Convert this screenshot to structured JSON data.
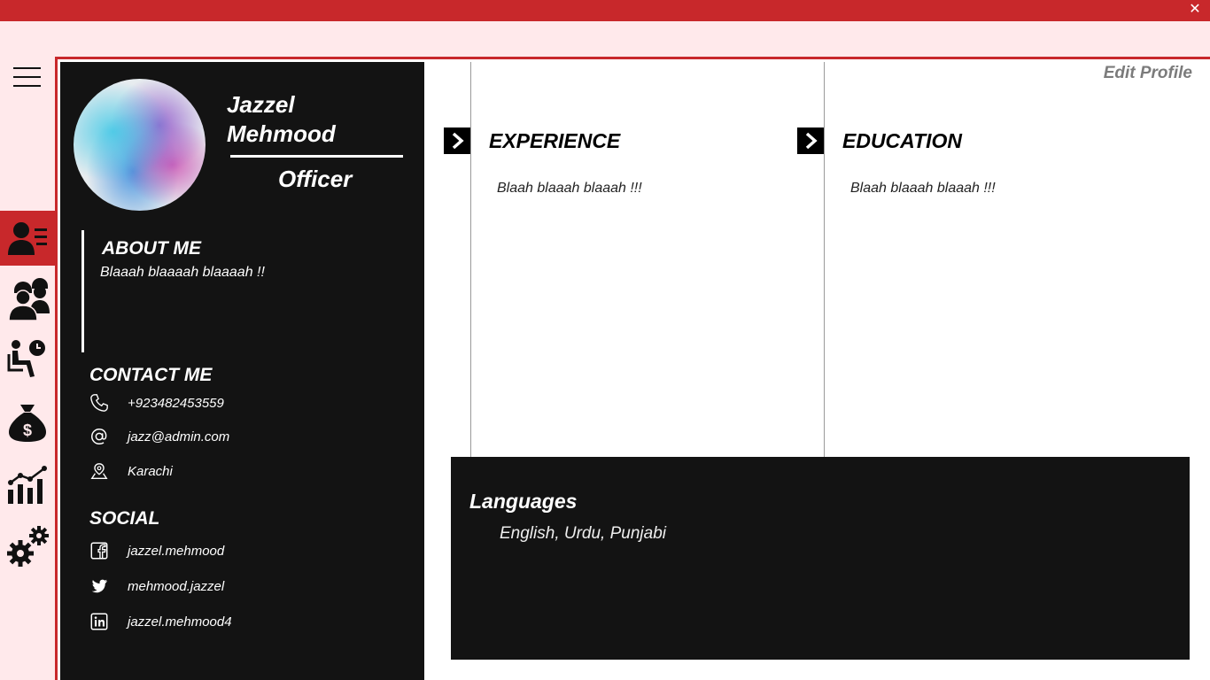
{
  "window": {
    "close_glyph": "✕"
  },
  "nav": {
    "items": [
      {
        "icon": "profile-list-icon",
        "active": true
      },
      {
        "icon": "workers-icon",
        "active": false
      },
      {
        "icon": "waiting-time-icon",
        "active": false
      },
      {
        "icon": "money-bag-icon",
        "active": false
      },
      {
        "icon": "growth-chart-icon",
        "active": false
      },
      {
        "icon": "settings-gears-icon",
        "active": false
      }
    ]
  },
  "profile": {
    "name_first": "Jazzel",
    "name_last": "Mehmood",
    "role": "Officer",
    "about_title": "ABOUT ME",
    "about_text": "Blaaah blaaaah blaaaah !!",
    "contact_title": "CONTACT ME",
    "phone": "+923482453559",
    "email": "jazz@admin.com",
    "location": "Karachi",
    "social_title": "SOCIAL",
    "facebook": "jazzel.mehmood",
    "twitter": "mehmood.jazzel",
    "linkedin": "jazzel.mehmood4"
  },
  "main": {
    "edit_profile": "Edit Profile",
    "experience_title": "EXPERIENCE",
    "experience_text": "Blaah blaaah blaaah !!!",
    "education_title": "EDUCATION",
    "education_text": "Blaah blaaah blaaah !!!",
    "languages_title": "Languages",
    "languages_text": "English, Urdu, Punjabi"
  },
  "colors": {
    "accent": "#c8282b",
    "panel": "#131313",
    "background": "#ffe9eb"
  }
}
